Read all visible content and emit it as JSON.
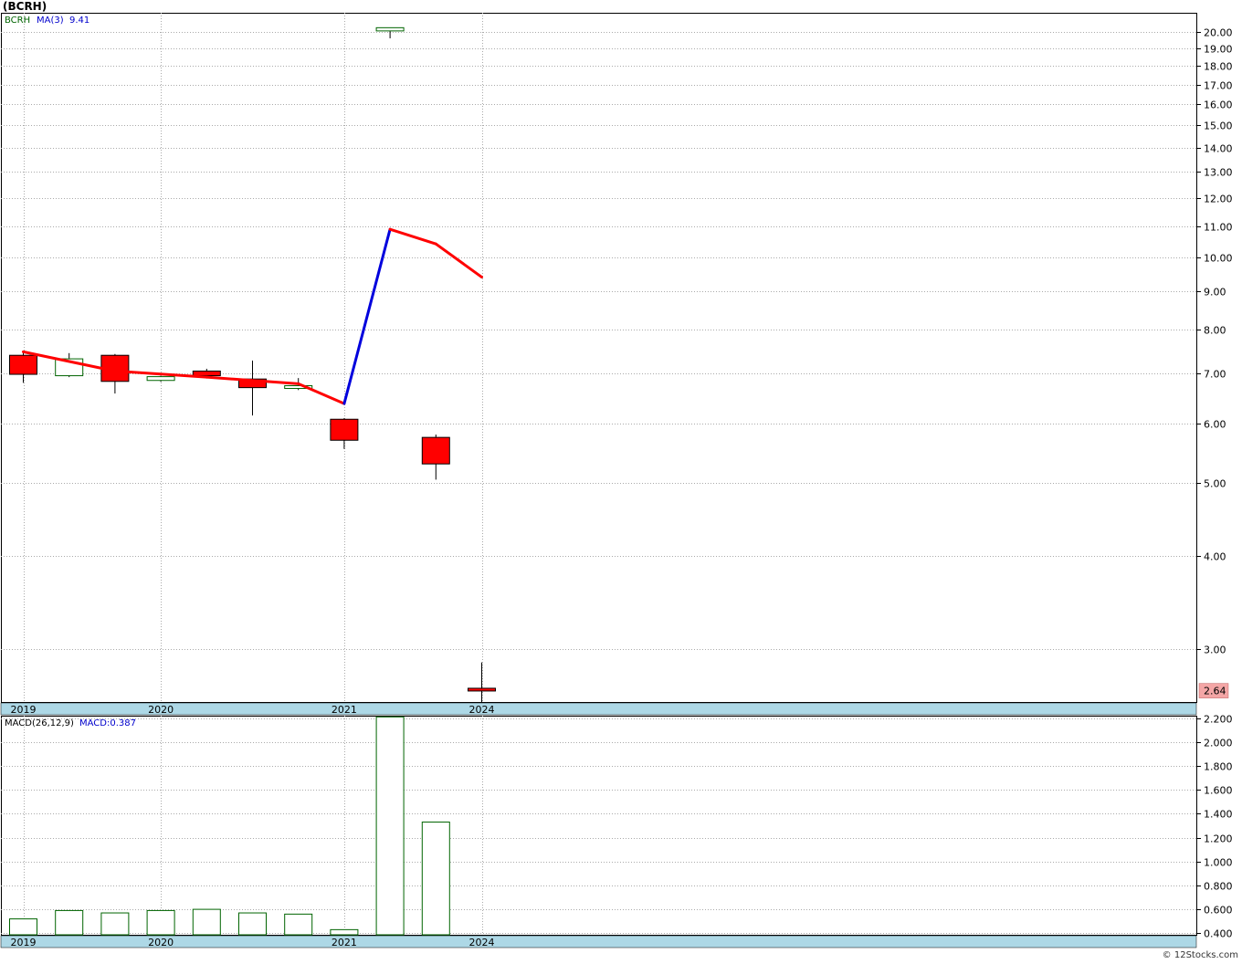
{
  "title": "(BCRH)",
  "credit": "© 12Stocks.com",
  "colors": {
    "up_body": "#ffffff",
    "up_border": "#006400",
    "down_body": "#ff0000",
    "ma_line": "#ff0000",
    "ma_up_line": "#0000dd",
    "grid": "#aaaaaa",
    "axis_band": "#add8e6",
    "price_badge": "#f4a6a6"
  },
  "chart_data": [
    {
      "type": "candlestick",
      "legend": {
        "symbol": "BCRH",
        "indicator": "MA(3)",
        "indicator_value": "9.41"
      },
      "y_scale": "log",
      "ylim": [
        2.55,
        21.2
      ],
      "y_ticks": [
        "20.00",
        "19.00",
        "18.00",
        "17.00",
        "16.00",
        "15.00",
        "14.00",
        "13.00",
        "12.00",
        "11.00",
        "10.00",
        "9.00",
        "8.00",
        "7.00",
        "6.00",
        "5.00",
        "4.00",
        "3.00"
      ],
      "x_labels": [
        "2019",
        "2020",
        "2021",
        "2024"
      ],
      "last_price_label": "2.64",
      "candles": [
        {
          "open": 7.4,
          "high": 7.5,
          "low": 6.8,
          "close": 6.98
        },
        {
          "open": 6.95,
          "high": 7.45,
          "low": 6.92,
          "close": 7.32
        },
        {
          "open": 7.4,
          "high": 7.43,
          "low": 6.58,
          "close": 6.83
        },
        {
          "open": 6.85,
          "high": 6.95,
          "low": 6.82,
          "close": 6.93
        },
        {
          "open": 7.05,
          "high": 7.1,
          "low": 6.92,
          "close": 6.95
        },
        {
          "open": 6.88,
          "high": 7.28,
          "low": 6.15,
          "close": 6.7
        },
        {
          "open": 6.72,
          "high": 6.9,
          "low": 6.65,
          "close": 6.74
        },
        {
          "open": 6.08,
          "high": 6.1,
          "low": 5.55,
          "close": 5.7
        },
        {
          "open": 20.05,
          "high": 20.25,
          "low": 19.6,
          "close": 20.25
        },
        {
          "open": 5.75,
          "high": 5.8,
          "low": 5.05,
          "close": 5.3
        },
        {
          "open": 2.66,
          "high": 2.88,
          "low": 2.55,
          "close": 2.64
        }
      ],
      "ma": [
        7.48,
        null,
        7.05,
        null,
        6.92,
        null,
        6.78,
        6.38,
        10.9,
        10.42,
        9.41
      ],
      "ma_rising": [
        false,
        false,
        false,
        false,
        false,
        false,
        false,
        true,
        false,
        false
      ]
    },
    {
      "type": "bar",
      "legend": {
        "indicator": "MACD(26,12,9)",
        "indicator_value": "MACD:0.387"
      },
      "ylim": [
        0.387,
        2.22
      ],
      "y_ticks": [
        "2.200",
        "2.000",
        "1.800",
        "1.600",
        "1.400",
        "1.200",
        "1.000",
        "0.800",
        "0.600",
        "0.400"
      ],
      "x_labels": [
        "2019",
        "2020",
        "2021",
        "2024"
      ],
      "values": [
        0.52,
        0.59,
        0.57,
        0.59,
        0.6,
        0.57,
        0.56,
        0.43,
        2.21,
        1.33,
        null
      ]
    }
  ]
}
